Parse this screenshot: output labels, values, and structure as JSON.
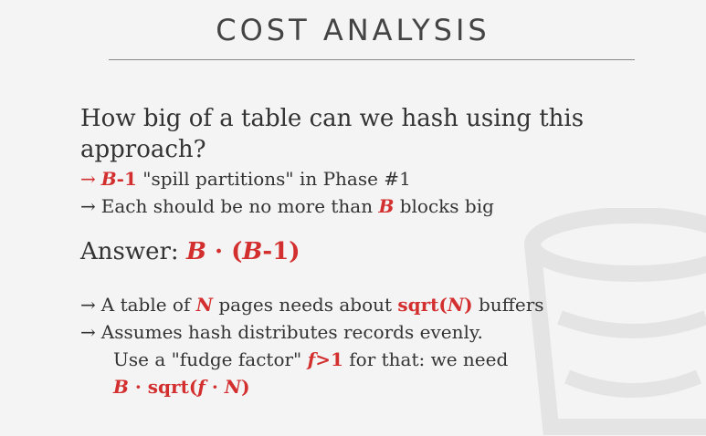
{
  "title": "COST ANALYSIS",
  "question": {
    "line1": "How big of a table can we hash using this",
    "line2": "approach?"
  },
  "bullet1": {
    "arrow": "→",
    "emph": "B",
    "part1": "-1",
    "text": " \"spill partitions\" in Phase #1"
  },
  "bullet2": {
    "arrow": "→",
    "text_a": "Each should be no more than ",
    "emph": "B",
    "text_b": " blocks big"
  },
  "answer": {
    "label": "Answer: ",
    "b1": "B",
    "dot": " · ",
    "open": "(",
    "b2": "B",
    "tail": "-1)"
  },
  "bullet3": {
    "arrow": "→",
    "text_a": "A table of ",
    "emph": "N",
    "text_b": " pages needs about ",
    "sqrt_a": "sqrt(",
    "sqrt_n": "N",
    "sqrt_b": ")",
    "text_c": " buffers"
  },
  "bullet4": {
    "arrow": "→",
    "line1": "Assumes hash distributes records evenly.",
    "line2_a": "Use a \"fudge factor\" ",
    "f": "f",
    "gt1": ">1",
    "line2_b": " for that: we need",
    "formula_b": "B",
    "formula_dot": " · ",
    "formula_sqrt": "sqrt(",
    "formula_f": "f",
    "formula_dot2": " · ",
    "formula_n": "N",
    "formula_close": ")"
  }
}
